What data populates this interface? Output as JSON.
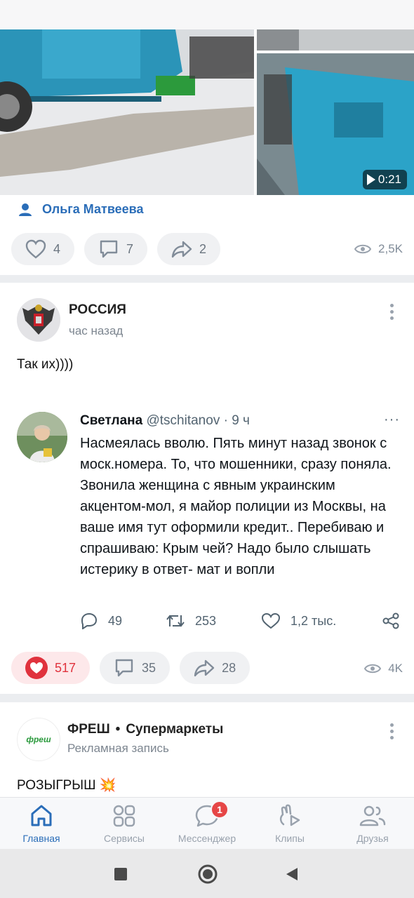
{
  "post1": {
    "video_duration": "0:21",
    "author": "Ольга Матвеева",
    "likes": "4",
    "comments": "7",
    "shares": "2",
    "views": "2,5K"
  },
  "post2": {
    "author": "РОССИЯ",
    "time": "час назад",
    "text": "Так их))))",
    "tweet": {
      "name": "Светлана",
      "handle": "@tschitanov",
      "time": "· 9 ч",
      "more": "···",
      "body": "Насмеялась вволю. Пять минут назад звонок с моск.номера. То, что мошенники, сразу поняла. Звонила женщина с явным украинским акцентом-мол, я майор полиции из Москвы, на ваше имя тут оформили кредит.. Перебиваю и спрашиваю: Крым чей? Надо было слышать истерику в ответ- мат и вопли",
      "replies": "49",
      "retweets": "253",
      "likes": "1,2 тыс."
    },
    "likes": "517",
    "comments": "35",
    "shares": "28",
    "views": "4K"
  },
  "post3": {
    "logo_text": "фреш",
    "author": "ФРЕШ",
    "separator": "•",
    "category": "Супермаркеты",
    "subtitle": "Рекламная запись",
    "text": "РОЗЫГРЫШ 💥"
  },
  "tabs": [
    {
      "label": "Главная",
      "icon": "home-icon"
    },
    {
      "label": "Сервисы",
      "icon": "services-icon"
    },
    {
      "label": "Мессенджер",
      "icon": "messenger-icon",
      "badge": "1"
    },
    {
      "label": "Клипы",
      "icon": "clips-icon"
    },
    {
      "label": "Друзья",
      "icon": "friends-icon"
    }
  ],
  "colors": {
    "accent": "#2a6db8",
    "like_red": "#e0323d",
    "badge_red": "#e64646",
    "secondary_text": "#818c99"
  }
}
